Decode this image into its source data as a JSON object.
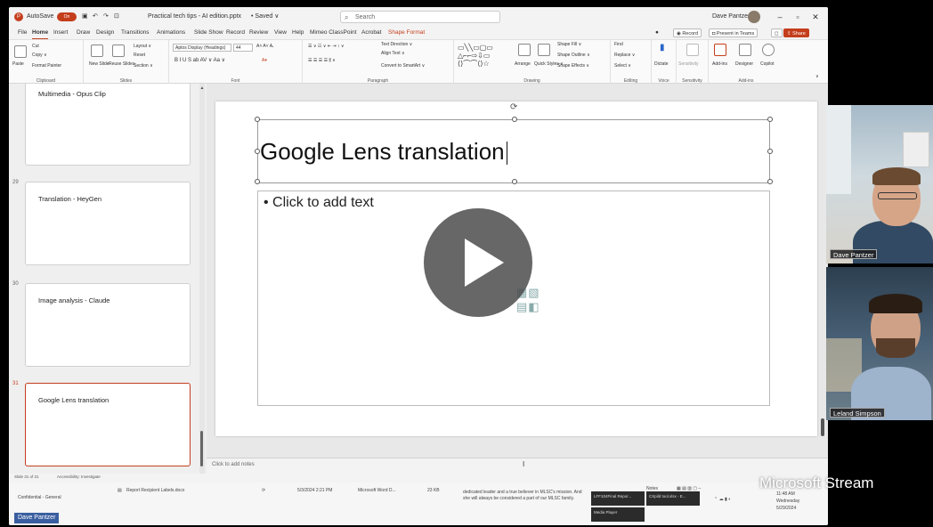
{
  "titlebar": {
    "autosave_label": "AutoSave",
    "autosave_state": "On",
    "doc_title": "Practical tech tips - AI edition.pptx",
    "saved_state": "• Saved ∨",
    "search_placeholder": "Search",
    "user_name": "Dave Pantzer"
  },
  "menu": {
    "tabs": [
      "File",
      "Home",
      "Insert",
      "Draw",
      "Design",
      "Transitions",
      "Animations",
      "Slide Show",
      "Record",
      "Review",
      "View",
      "Help",
      "Mimeo ClassPoint",
      "Acrobat",
      "Shape Format"
    ],
    "record_label": "Record",
    "present_teams_label": "Present in Teams",
    "share_label": "Share"
  },
  "ribbon": {
    "clipboard": {
      "paste": "Paste",
      "cut": "Cut",
      "copy": "Copy ∨",
      "format_painter": "Format Painter",
      "label": "Clipboard"
    },
    "slides": {
      "new_slide": "New Slide",
      "reuse_slides": "Reuse Slides",
      "layout": "Layout ∨",
      "reset": "Reset",
      "section": "Section ∨",
      "label": "Slides"
    },
    "font": {
      "font_name": "Aptos Display (Headings)",
      "font_size": "44",
      "label": "Font",
      "format_row": "B  I  U  S  ab  AV ∨  Aa ∨"
    },
    "paragraph": {
      "text_direction": "Text Direction ∨",
      "align_text": "Align Text ∨",
      "convert_smartart": "Convert to SmartArt ∨",
      "label": "Paragraph"
    },
    "drawing": {
      "arrange": "Arrange",
      "quick_styles": "Quick Styles ∨",
      "shape_fill": "Shape Fill ∨",
      "shape_outline": "Shape Outline ∨",
      "shape_effects": "Shape Effects ∨",
      "label": "Drawing"
    },
    "editing": {
      "find": "Find",
      "replace": "Replace ∨",
      "select": "Select ∨",
      "label": "Editing"
    },
    "voice": {
      "dictate": "Dictate",
      "label": "Voice"
    },
    "sensitivity": {
      "sensitivity": "Sensitivity",
      "label": "Sensitivity"
    },
    "addins": {
      "addins": "Add-ins",
      "designer": "Designer",
      "copilot": "Copilot",
      "label": "Add-ins"
    }
  },
  "thumbnails": [
    {
      "number": "",
      "text": "Multimedia - Opus Clip",
      "selected": false
    },
    {
      "number": "29",
      "text": "Translation - HeyGen",
      "selected": false
    },
    {
      "number": "30",
      "text": "Image analysis - Claude",
      "selected": false
    },
    {
      "number": "31",
      "text": "Google Lens translation",
      "selected": true
    }
  ],
  "slide": {
    "title": "Google Lens translation",
    "content_placeholder": "• Click to add text"
  },
  "notes": {
    "placeholder": "Click to add notes"
  },
  "statusbar": {
    "slide_count": "Slide 31 of 31",
    "accessibility": "Accessibility: Investigate"
  },
  "taskbar": {
    "file_item": "Report Recipient Labels.docx",
    "file_date": "5/3/2024 2:21 PM",
    "file_type": "Microsoft Word D...",
    "file_size": "23 KB",
    "text_snippet": "dedicated leader and a true believer in MLSC's mission. And she will always be considered a part of our MLSC family.",
    "left_item_1": "Confidential - General",
    "app_1": "LFF104Final Repor...",
    "app_2": "CSpild tool.xlsx - E...",
    "app_3": "Media Player",
    "notes_btn": "Notes",
    "time": "11:48 AM",
    "day": "Wednesday",
    "date": "5/29/2024"
  },
  "participants": [
    {
      "name": "Dave Pantzer"
    },
    {
      "name": "Leland Simpson"
    }
  ],
  "overlay": {
    "watermark": "Microsoft Stream",
    "presenter": "Dave Pantzer",
    "play_icon": "play-icon"
  }
}
